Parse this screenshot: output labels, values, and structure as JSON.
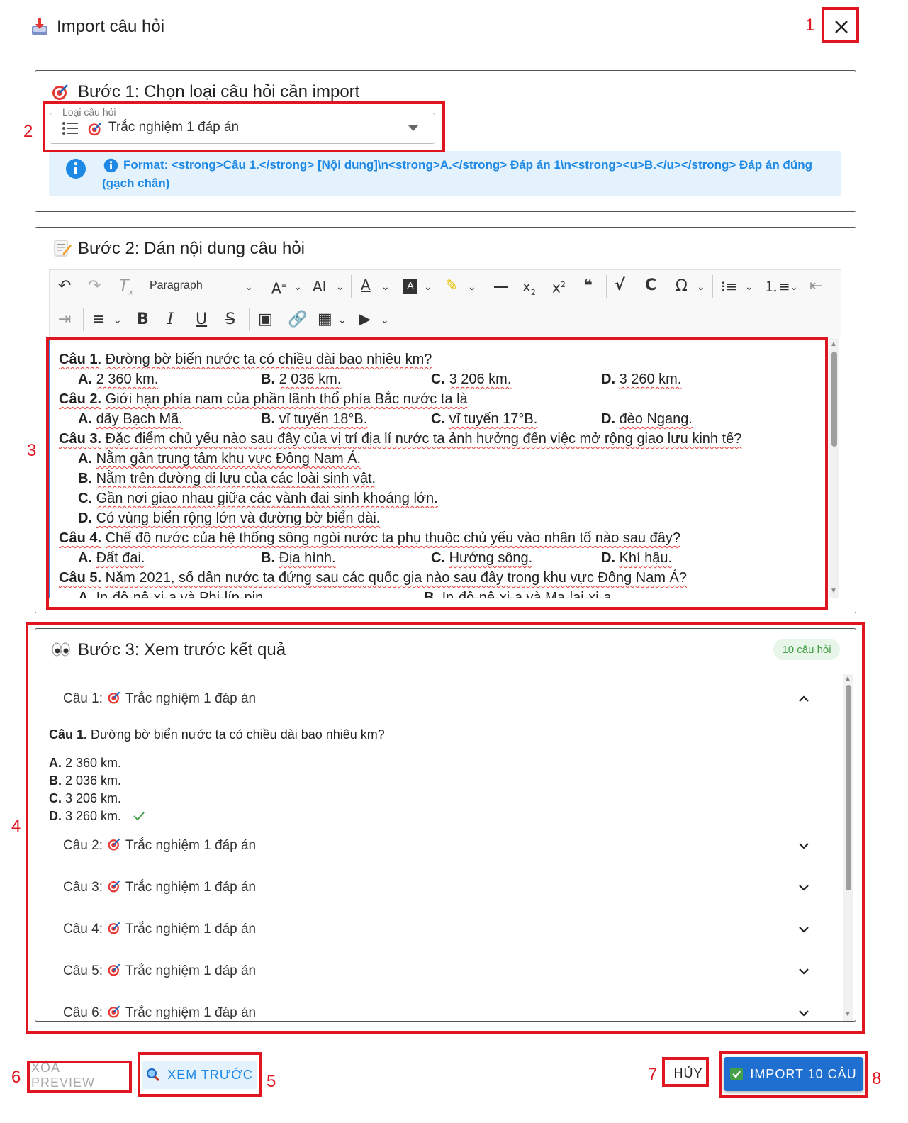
{
  "dialog": {
    "title": "Import câu hỏi",
    "close_icon": "close-icon"
  },
  "step1": {
    "title": "Bước 1: Chọn loại câu hỏi cần import",
    "select_label": "Loại câu hỏi",
    "select_value": "Trắc nghiệm 1 đáp án",
    "format_hint": "Format: <strong>Câu 1.</strong> [Nội dung]\\n<strong>A.</strong> Đáp án 1\\n<strong><u>B.</u></strong> Đáp án đúng (gạch chân)"
  },
  "step2": {
    "title": "Bước 2: Dán nội dung câu hỏi",
    "toolbar": {
      "paragraph": "Paragraph",
      "bold": "B",
      "italic": "I",
      "underline": "U",
      "strike": "S"
    },
    "editor": {
      "lines": [
        {
          "label": "Câu 1.",
          "text": "Đường bờ biển nước ta có chiều dài bao nhiêu km?"
        },
        {
          "options": [
            [
              "A.",
              "2 360 km."
            ],
            [
              "B.",
              "2 036 km."
            ],
            [
              "C.",
              "3 206 km."
            ],
            [
              "D.",
              "3 260 km."
            ]
          ]
        },
        {
          "label": "Câu 2.",
          "text": "Giới hạn phía nam của phần lãnh thổ phía Bắc nước ta là"
        },
        {
          "options": [
            [
              "A.",
              "dãy Bạch Mã."
            ],
            [
              "B.",
              "vĩ tuyến 18°B."
            ],
            [
              "C.",
              "vĩ tuyến 17°B."
            ],
            [
              "D.",
              "đèo Ngang."
            ]
          ]
        },
        {
          "label": "Câu 3.",
          "text": "Đặc điểm chủ yếu nào sau đây của vị trí địa lí nước ta ảnh hưởng đến việc mở rộng giao lưu kinh tế?"
        },
        {
          "options": [
            [
              "A.",
              "Nằm gần trung tâm khu vực Đông Nam Á."
            ]
          ]
        },
        {
          "options": [
            [
              "B.",
              "Nằm trên đường di lưu của các loài sinh vật."
            ]
          ]
        },
        {
          "options": [
            [
              "C.",
              "Gần nơi giao nhau giữa các vành đai sinh khoáng lớn."
            ]
          ]
        },
        {
          "options": [
            [
              "D.",
              "Có vùng biển rộng lớn và đường bờ biển dài."
            ]
          ]
        },
        {
          "label": "Câu 4.",
          "text": "Chế độ nước của hệ thống sông ngòi nước ta phụ thuộc chủ yếu vào nhân tố nào sau đây?"
        },
        {
          "options": [
            [
              "A.",
              "Đất đai."
            ],
            [
              "B.",
              "Địa hình."
            ],
            [
              "C.",
              "Hướng sông."
            ],
            [
              "D.",
              "Khí hậu."
            ]
          ]
        },
        {
          "label": "Câu 5.",
          "text": "Năm 2021, số dân nước ta đứng sau các quốc gia nào sau đây trong khu vực Đông Nam Á?"
        },
        {
          "options": [
            [
              "A.",
              "In-đô-nê-xi-a và Phi-líp-pin."
            ],
            [
              "B.",
              "In-đô-nê-xi-a và Ma-lai-xi-a."
            ]
          ]
        }
      ]
    }
  },
  "step3": {
    "title": "Bước 3: Xem trước kết quả",
    "count_badge": "10 câu hỏi",
    "questions": [
      {
        "prefix": "Câu 1:",
        "type": "Trắc nghiệm 1 đáp án",
        "expanded": true
      },
      {
        "prefix": "Câu 2:",
        "type": "Trắc nghiệm 1 đáp án",
        "expanded": false
      },
      {
        "prefix": "Câu 3:",
        "type": "Trắc nghiệm 1 đáp án",
        "expanded": false
      },
      {
        "prefix": "Câu 4:",
        "type": "Trắc nghiệm 1 đáp án",
        "expanded": false
      },
      {
        "prefix": "Câu 5:",
        "type": "Trắc nghiệm 1 đáp án",
        "expanded": false
      },
      {
        "prefix": "Câu 6:",
        "type": "Trắc nghiệm 1 đáp án",
        "expanded": false
      }
    ],
    "expanded_question": {
      "label": "Câu 1.",
      "text": "Đường bờ biển nước ta có chiều dài bao nhiêu km?",
      "answers": [
        {
          "label": "A.",
          "text": "2 360 km.",
          "correct": false
        },
        {
          "label": "B.",
          "text": "2 036 km.",
          "correct": false
        },
        {
          "label": "C.",
          "text": "3 206 km.",
          "correct": false
        },
        {
          "label": "D.",
          "text": "3 260 km.",
          "correct": true
        }
      ]
    }
  },
  "actions": {
    "clear_preview": "XÓA PREVIEW",
    "preview": "XEM TRƯỚC",
    "cancel": "HỦY",
    "import": "IMPORT 10 CÂU"
  },
  "annotations": [
    "1",
    "2",
    "3",
    "4",
    "5",
    "6",
    "7",
    "8"
  ],
  "colors": {
    "annotation_red": "#e0151f",
    "primary_blue": "#1e6fd0",
    "info_blue": "#1e88e5",
    "success_green": "#43a047"
  }
}
